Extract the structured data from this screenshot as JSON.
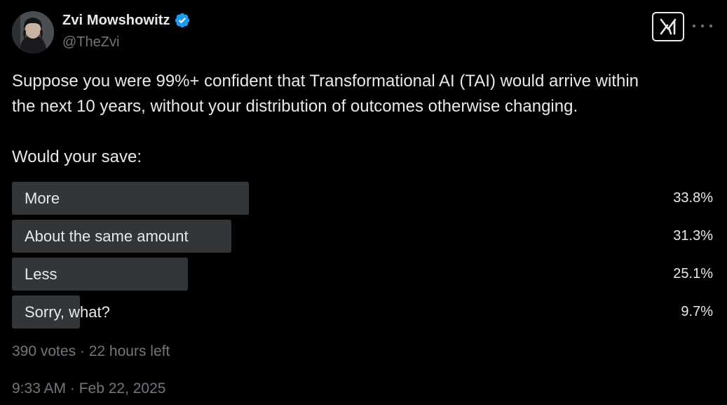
{
  "author": {
    "display_name": "Zvi Mowshowitz",
    "handle": "@TheZvi",
    "verified": true
  },
  "colors": {
    "background": "#000000",
    "text_primary": "#e7e9ea",
    "text_secondary": "#71767b",
    "poll_bar": "#333639",
    "verified_badge": "#1d9bf0"
  },
  "icons": {
    "verified": "verified-badge-icon",
    "grok": "grok-icon",
    "more": "more-options-icon"
  },
  "tweet": {
    "line1": "Suppose you were 99%+ confident that Transformational AI (TAI) would arrive within",
    "line2": "the next 10 years, without your distribution of outcomes otherwise changing.",
    "question": "Would your save:"
  },
  "poll": {
    "options": [
      {
        "label": "More",
        "percent_text": "33.8%",
        "percent": 33.8
      },
      {
        "label": "About the same amount",
        "percent_text": "31.3%",
        "percent": 31.3
      },
      {
        "label": "Less",
        "percent_text": "25.1%",
        "percent": 25.1
      },
      {
        "label": "Sorry, what?",
        "percent_text": "9.7%",
        "percent": 9.7
      }
    ],
    "meta": "390 votes · 22 hours left"
  },
  "timestamp": "9:33 AM · Feb 22, 2025"
}
